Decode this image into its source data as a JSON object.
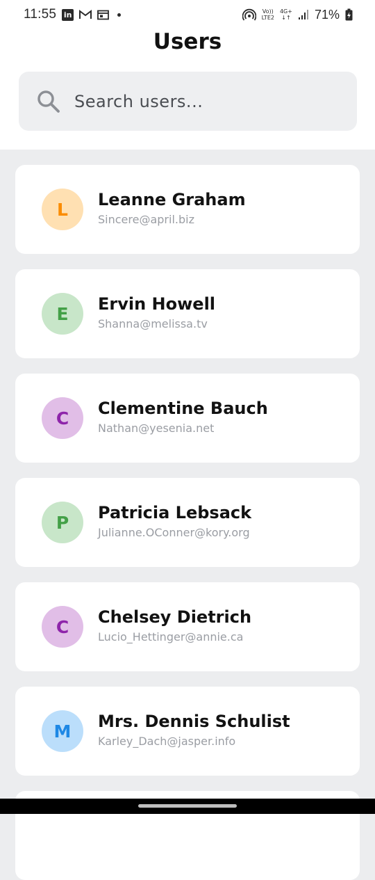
{
  "status_bar": {
    "time": "11:55",
    "linkedin_label": "in",
    "volte_top": "Vo))",
    "volte_bottom": "LTE2",
    "network_top": "4G+",
    "network_bottom": "↓↑",
    "battery": "71%"
  },
  "header": {
    "title": "Users"
  },
  "search": {
    "placeholder": "Search users..."
  },
  "users": [
    {
      "initial": "L",
      "name": "Leanne Graham",
      "email": "Sincere@april.biz",
      "avatar_bg": "#FFE0B2",
      "avatar_fg": "#FB8C00"
    },
    {
      "initial": "E",
      "name": "Ervin Howell",
      "email": "Shanna@melissa.tv",
      "avatar_bg": "#C8E6C9",
      "avatar_fg": "#43A047"
    },
    {
      "initial": "C",
      "name": "Clementine Bauch",
      "email": "Nathan@yesenia.net",
      "avatar_bg": "#E1BEE7",
      "avatar_fg": "#8E24AA"
    },
    {
      "initial": "P",
      "name": "Patricia Lebsack",
      "email": "Julianne.OConner@kory.org",
      "avatar_bg": "#C8E6C9",
      "avatar_fg": "#43A047"
    },
    {
      "initial": "C",
      "name": "Chelsey Dietrich",
      "email": "Lucio_Hettinger@annie.ca",
      "avatar_bg": "#E1BEE7",
      "avatar_fg": "#8E24AA"
    },
    {
      "initial": "M",
      "name": "Mrs. Dennis Schulist",
      "email": "Karley_Dach@jasper.info",
      "avatar_bg": "#BBDEFB",
      "avatar_fg": "#1E88E5"
    }
  ]
}
